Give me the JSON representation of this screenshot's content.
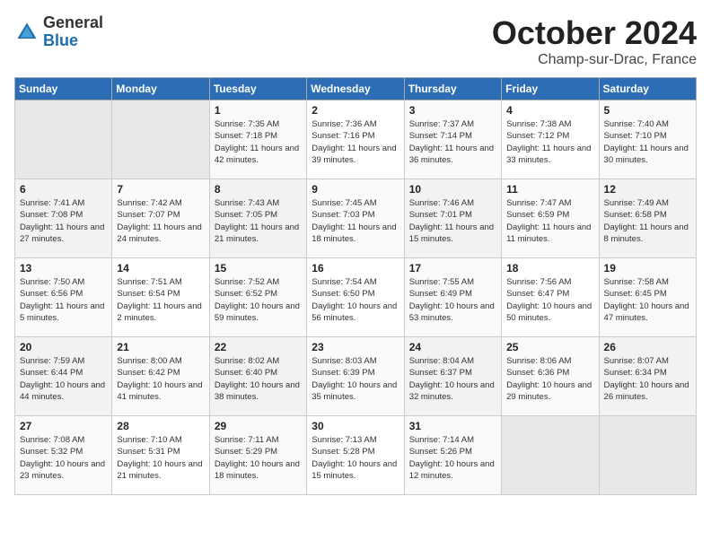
{
  "header": {
    "logo_general": "General",
    "logo_blue": "Blue",
    "month": "October 2024",
    "location": "Champ-sur-Drac, France"
  },
  "weekdays": [
    "Sunday",
    "Monday",
    "Tuesday",
    "Wednesday",
    "Thursday",
    "Friday",
    "Saturday"
  ],
  "weeks": [
    [
      {
        "day": "",
        "info": ""
      },
      {
        "day": "",
        "info": ""
      },
      {
        "day": "1",
        "info": "Sunrise: 7:35 AM\nSunset: 7:18 PM\nDaylight: 11 hours and 42 minutes."
      },
      {
        "day": "2",
        "info": "Sunrise: 7:36 AM\nSunset: 7:16 PM\nDaylight: 11 hours and 39 minutes."
      },
      {
        "day": "3",
        "info": "Sunrise: 7:37 AM\nSunset: 7:14 PM\nDaylight: 11 hours and 36 minutes."
      },
      {
        "day": "4",
        "info": "Sunrise: 7:38 AM\nSunset: 7:12 PM\nDaylight: 11 hours and 33 minutes."
      },
      {
        "day": "5",
        "info": "Sunrise: 7:40 AM\nSunset: 7:10 PM\nDaylight: 11 hours and 30 minutes."
      }
    ],
    [
      {
        "day": "6",
        "info": "Sunrise: 7:41 AM\nSunset: 7:08 PM\nDaylight: 11 hours and 27 minutes."
      },
      {
        "day": "7",
        "info": "Sunrise: 7:42 AM\nSunset: 7:07 PM\nDaylight: 11 hours and 24 minutes."
      },
      {
        "day": "8",
        "info": "Sunrise: 7:43 AM\nSunset: 7:05 PM\nDaylight: 11 hours and 21 minutes."
      },
      {
        "day": "9",
        "info": "Sunrise: 7:45 AM\nSunset: 7:03 PM\nDaylight: 11 hours and 18 minutes."
      },
      {
        "day": "10",
        "info": "Sunrise: 7:46 AM\nSunset: 7:01 PM\nDaylight: 11 hours and 15 minutes."
      },
      {
        "day": "11",
        "info": "Sunrise: 7:47 AM\nSunset: 6:59 PM\nDaylight: 11 hours and 11 minutes."
      },
      {
        "day": "12",
        "info": "Sunrise: 7:49 AM\nSunset: 6:58 PM\nDaylight: 11 hours and 8 minutes."
      }
    ],
    [
      {
        "day": "13",
        "info": "Sunrise: 7:50 AM\nSunset: 6:56 PM\nDaylight: 11 hours and 5 minutes."
      },
      {
        "day": "14",
        "info": "Sunrise: 7:51 AM\nSunset: 6:54 PM\nDaylight: 11 hours and 2 minutes."
      },
      {
        "day": "15",
        "info": "Sunrise: 7:52 AM\nSunset: 6:52 PM\nDaylight: 10 hours and 59 minutes."
      },
      {
        "day": "16",
        "info": "Sunrise: 7:54 AM\nSunset: 6:50 PM\nDaylight: 10 hours and 56 minutes."
      },
      {
        "day": "17",
        "info": "Sunrise: 7:55 AM\nSunset: 6:49 PM\nDaylight: 10 hours and 53 minutes."
      },
      {
        "day": "18",
        "info": "Sunrise: 7:56 AM\nSunset: 6:47 PM\nDaylight: 10 hours and 50 minutes."
      },
      {
        "day": "19",
        "info": "Sunrise: 7:58 AM\nSunset: 6:45 PM\nDaylight: 10 hours and 47 minutes."
      }
    ],
    [
      {
        "day": "20",
        "info": "Sunrise: 7:59 AM\nSunset: 6:44 PM\nDaylight: 10 hours and 44 minutes."
      },
      {
        "day": "21",
        "info": "Sunrise: 8:00 AM\nSunset: 6:42 PM\nDaylight: 10 hours and 41 minutes."
      },
      {
        "day": "22",
        "info": "Sunrise: 8:02 AM\nSunset: 6:40 PM\nDaylight: 10 hours and 38 minutes."
      },
      {
        "day": "23",
        "info": "Sunrise: 8:03 AM\nSunset: 6:39 PM\nDaylight: 10 hours and 35 minutes."
      },
      {
        "day": "24",
        "info": "Sunrise: 8:04 AM\nSunset: 6:37 PM\nDaylight: 10 hours and 32 minutes."
      },
      {
        "day": "25",
        "info": "Sunrise: 8:06 AM\nSunset: 6:36 PM\nDaylight: 10 hours and 29 minutes."
      },
      {
        "day": "26",
        "info": "Sunrise: 8:07 AM\nSunset: 6:34 PM\nDaylight: 10 hours and 26 minutes."
      }
    ],
    [
      {
        "day": "27",
        "info": "Sunrise: 7:08 AM\nSunset: 5:32 PM\nDaylight: 10 hours and 23 minutes."
      },
      {
        "day": "28",
        "info": "Sunrise: 7:10 AM\nSunset: 5:31 PM\nDaylight: 10 hours and 21 minutes."
      },
      {
        "day": "29",
        "info": "Sunrise: 7:11 AM\nSunset: 5:29 PM\nDaylight: 10 hours and 18 minutes."
      },
      {
        "day": "30",
        "info": "Sunrise: 7:13 AM\nSunset: 5:28 PM\nDaylight: 10 hours and 15 minutes."
      },
      {
        "day": "31",
        "info": "Sunrise: 7:14 AM\nSunset: 5:26 PM\nDaylight: 10 hours and 12 minutes."
      },
      {
        "day": "",
        "info": ""
      },
      {
        "day": "",
        "info": ""
      }
    ]
  ]
}
